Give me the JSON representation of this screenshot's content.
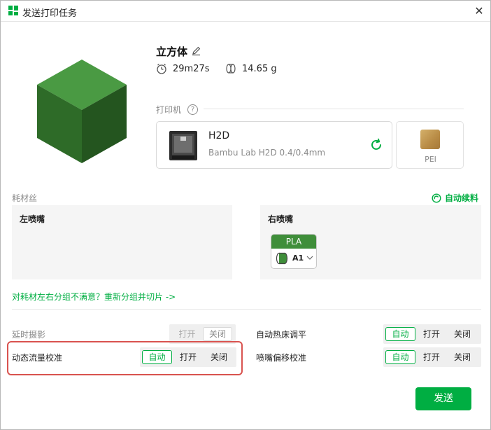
{
  "window": {
    "title": "发送打印任务",
    "close_icon": "close-icon",
    "app_icon": "bambu-studio-icon"
  },
  "model": {
    "name": "立方体",
    "print_time": "29m27s",
    "weight": "14.65 g",
    "cube_colors": {
      "top": "#4a9a43",
      "left": "#2e6b28",
      "right": "#24551f"
    }
  },
  "printer_section": {
    "label": "打印机",
    "printer": {
      "name": "H2D",
      "details": "Bambu Lab H2D  0.4/0.4mm"
    },
    "plate": {
      "label": "PEI"
    }
  },
  "filament_section": {
    "label": "耗材丝",
    "auto_refill": "自动续料",
    "left_nozzle": {
      "title": "左喷嘴"
    },
    "right_nozzle": {
      "title": "右喷嘴",
      "filament": {
        "type": "PLA",
        "slot": "A1",
        "color": "#3f8e3a"
      }
    },
    "regroup_link": "对耗材左右分组不满意？重新分组并切片 ->"
  },
  "options": {
    "timelapse": {
      "label": "延时摄影",
      "buttons": [
        "打开",
        "关闭"
      ],
      "selected": "关闭",
      "enabled": false
    },
    "flow_calibration": {
      "label": "动态流量校准",
      "buttons": [
        "自动",
        "打开",
        "关闭"
      ],
      "selected": "自动"
    },
    "bed_leveling": {
      "label": "自动热床调平",
      "buttons": [
        "自动",
        "打开",
        "关闭"
      ],
      "selected": "自动"
    },
    "nozzle_offset": {
      "label": "喷嘴偏移校准",
      "buttons": [
        "自动",
        "打开",
        "关闭"
      ],
      "selected": "自动"
    }
  },
  "send_button": "发送",
  "colors": {
    "accent": "#00ae42",
    "highlight": "#d9534f"
  }
}
